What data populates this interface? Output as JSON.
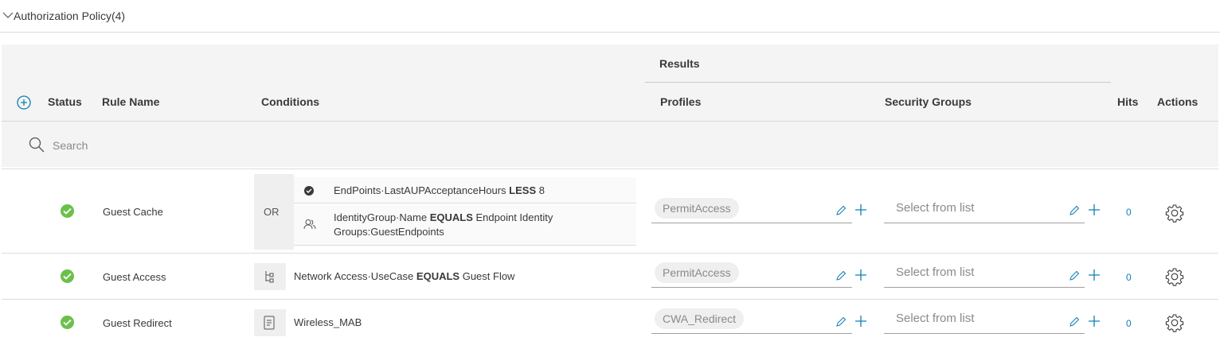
{
  "section": {
    "title": "Authorization Policy(4)"
  },
  "table": {
    "results_label": "Results",
    "headers": {
      "status": "Status",
      "rule_name": "Rule Name",
      "conditions": "Conditions",
      "profiles": "Profiles",
      "security_groups": "Security Groups",
      "hits": "Hits",
      "actions": "Actions"
    },
    "search_placeholder": "Search"
  },
  "rows": [
    {
      "status": "enabled",
      "name": "Guest Cache",
      "operator": "OR",
      "conditions": [
        {
          "icon": "check-circle-icon",
          "attribute": "EndPoints·LastAUPAcceptanceHours",
          "op": "LESS",
          "value": "8"
        },
        {
          "icon": "user-group-icon",
          "attribute": "IdentityGroup·Name",
          "op": "EQUALS",
          "value": "Endpoint Identity",
          "value2": "Groups:GuestEndpoints"
        }
      ],
      "profile": "PermitAccess",
      "security_group_placeholder": "Select from list",
      "hits": "0"
    },
    {
      "status": "enabled",
      "name": "Guest Access",
      "condition": {
        "icon": "network-tree-icon",
        "attribute": "Network Access·UseCase",
        "op": "EQUALS",
        "value": "Guest Flow"
      },
      "profile": "PermitAccess",
      "security_group_placeholder": "Select from list",
      "hits": "0"
    },
    {
      "status": "enabled",
      "name": "Guest Redirect",
      "condition": {
        "icon": "document-icon",
        "text": "Wireless_MAB"
      },
      "profile": "CWA_Redirect",
      "security_group_placeholder": "Select from list",
      "hits": "0"
    }
  ],
  "colors": {
    "status_green": "#6cc04a",
    "accent_blue": "#0d7fb3",
    "header_bg": "#f4f4f4"
  }
}
